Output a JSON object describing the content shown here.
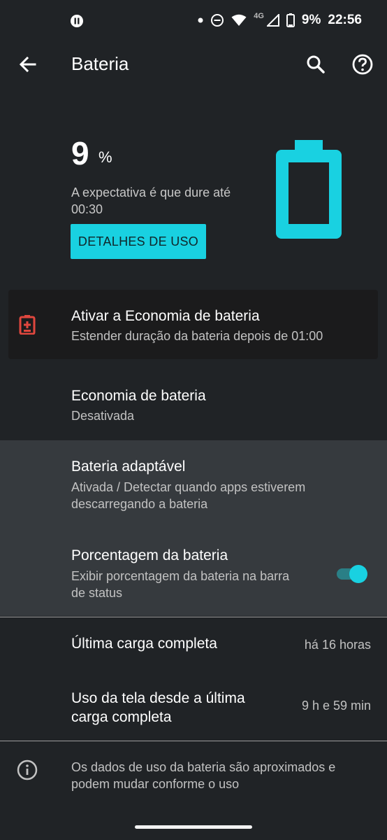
{
  "status_bar": {
    "time": "22:56",
    "battery_percent": "9%",
    "network": "4G",
    "icons": [
      "media-pause-icon",
      "dot-icon",
      "do-not-disturb-icon",
      "wifi-icon",
      "signal-icon",
      "battery-icon"
    ]
  },
  "app_bar": {
    "title": "Bateria",
    "icons": [
      "back-arrow-icon",
      "search-icon",
      "help-icon"
    ]
  },
  "summary": {
    "percent_value": "9",
    "percent_sign": "%",
    "battery_level": 0.09,
    "expectation": "A expectativa é que dure até 00:30",
    "details_button": "DETALHES DE USO"
  },
  "saver_card": {
    "title": "Ativar a Economia de bateria",
    "subtitle": "Estender duração da bateria depois de 01:00"
  },
  "settings": {
    "economy": {
      "title": "Economia de bateria",
      "subtitle": "Desativada"
    },
    "adaptive": {
      "title": "Bateria adaptável",
      "subtitle": "Ativada / Detectar quando apps estiverem descarregando a bateria"
    },
    "percentage": {
      "title": "Porcentagem da bateria",
      "subtitle": "Exibir porcentagem da bateria na barra de status",
      "enabled": true
    },
    "last_charge": {
      "title": "Última carga completa",
      "value": "há 16 horas"
    },
    "screen_usage": {
      "title": "Uso da tela desde a última carga completa",
      "value": "9 h e 59 min"
    }
  },
  "info_note": "Os dados de uso da bateria são aproximados e podem mudar conforme o uso",
  "colors": {
    "background": "#202326",
    "accent": "#19d1e1",
    "highlight": "#363a3e",
    "card": "#1b1b1c",
    "warning": "#e0473e"
  }
}
